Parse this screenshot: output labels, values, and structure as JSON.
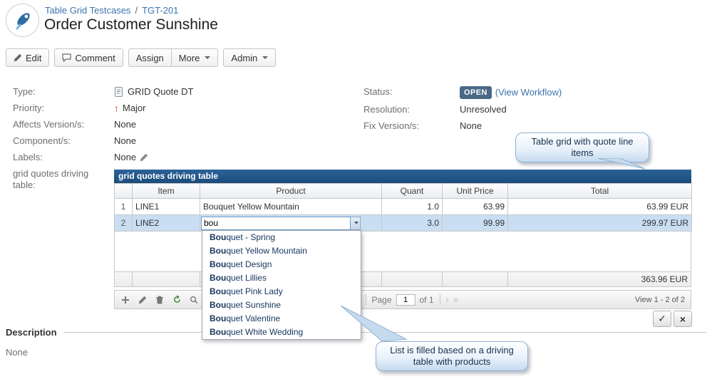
{
  "breadcrumb": {
    "project": "Table Grid Testcases",
    "sep": "/",
    "issue": "TGT-201"
  },
  "title": "Order Customer Sunshine",
  "toolbar": {
    "edit": "Edit",
    "comment": "Comment",
    "assign": "Assign",
    "more": "More",
    "admin": "Admin"
  },
  "fields": {
    "type_label": "Type:",
    "type_value": "GRID Quote DT",
    "priority_label": "Priority:",
    "priority_value": "Major",
    "affects_label": "Affects Version/s:",
    "affects_value": "None",
    "component_label": "Component/s:",
    "component_value": "None",
    "labels_label": "Labels:",
    "labels_value": "None",
    "grid_field_label": "grid quotes driving table:",
    "status_label": "Status:",
    "status_badge": "OPEN",
    "status_link": "(View Workflow)",
    "resolution_label": "Resolution:",
    "resolution_value": "Unresolved",
    "fix_label": "Fix Version/s:",
    "fix_value": "None"
  },
  "grid": {
    "title": "grid quotes driving table",
    "columns": {
      "item": "Item",
      "product": "Product",
      "quant": "Quant",
      "unit_price": "Unit Price",
      "total": "Total"
    },
    "rows": [
      {
        "num": "1",
        "item": "LINE1",
        "product": "Bouquet Yellow Mountain",
        "quant": "1.0",
        "unit_price": "63.99",
        "total": "63.99 EUR"
      },
      {
        "num": "2",
        "item": "LINE2",
        "product_input": "bou",
        "quant": "3.0",
        "unit_price": "99.99",
        "total": "299.97 EUR"
      }
    ],
    "footer_total": "363.96 EUR",
    "pager": {
      "page_label": "Page",
      "page_value": "1",
      "of_label": "of 1",
      "first": "«",
      "prev": "‹",
      "next": "›",
      "last": "»",
      "view_info": "View 1 - 2 of 2"
    }
  },
  "dropdown": {
    "bold_prefix": "Bou",
    "items": [
      "Bouquet - Spring",
      "Bouquet Yellow Mountain",
      "Bouquet Design",
      "Bouquet Lillies",
      "Bouquet Pink Lady",
      "Bouquet Sunshine",
      "Bouquet Valentine",
      "Bouquet White Wedding"
    ]
  },
  "callouts": {
    "grid": "Table grid with quote line items",
    "list": "List is filled based on a driving table with products"
  },
  "confirm": {
    "save": "✓",
    "cancel": "×"
  },
  "description": {
    "heading": "Description",
    "value": "None"
  },
  "colors": {
    "link": "#3b73af",
    "status_badge_bg": "#4a6785",
    "grid_header_bg": "#1c4b7a",
    "selected_row_bg": "#c9def2",
    "priority_icon": "#d04437"
  }
}
